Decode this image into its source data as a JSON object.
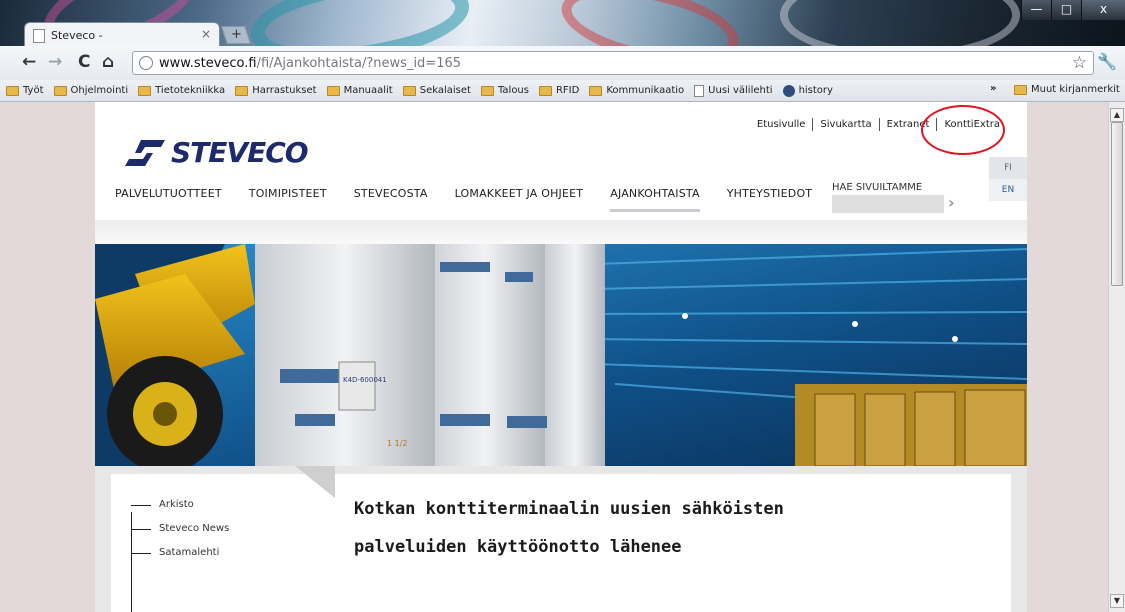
{
  "browser": {
    "tab_title": "Steveco -",
    "tab_close": "×",
    "new_tab": "+",
    "url_host": "www.steveco.fi",
    "url_rest": "/fi/Ajankohtaista/?news_id=165",
    "window_controls": {
      "minimize": "—",
      "maximize": "□",
      "close": "x"
    },
    "nav": {
      "back": "←",
      "forward": "→",
      "reload": "C",
      "home": "⌂"
    },
    "star": "☆",
    "wrench": "🔧",
    "bookmarks": [
      {
        "label": "Työt",
        "icon": "folder-icon"
      },
      {
        "label": "Ohjelmointi",
        "icon": "folder-icon"
      },
      {
        "label": "Tietotekniikka",
        "icon": "folder-icon"
      },
      {
        "label": "Harrastukset",
        "icon": "folder-icon"
      },
      {
        "label": "Manuaalit",
        "icon": "folder-icon"
      },
      {
        "label": "Sekalaiset",
        "icon": "folder-icon"
      },
      {
        "label": "Talous",
        "icon": "folder-icon"
      },
      {
        "label": "RFID",
        "icon": "folder-icon"
      },
      {
        "label": "Kommunikaatio",
        "icon": "folder-icon"
      },
      {
        "label": "Uusi välilehti",
        "icon": "page-icon"
      },
      {
        "label": "history",
        "icon": "clock-icon"
      }
    ],
    "bookmarks_more": "»",
    "other_bookmarks": "Muut kirjanmerkit"
  },
  "site": {
    "logo_text": "STEVECO",
    "top_links": [
      "Etusivulle",
      "Sivukartta",
      "Extranet",
      "KonttiExtra"
    ],
    "languages": [
      "FI",
      "EN"
    ],
    "main_nav": [
      {
        "label": "PALVELUTUOTTEET",
        "active": false
      },
      {
        "label": "TOIMIPISTEET",
        "active": false
      },
      {
        "label": "STEVECOSTA",
        "active": false
      },
      {
        "label": "LOMAKKEET JA OHJEET",
        "active": false
      },
      {
        "label": "AJANKOHTAISTA",
        "active": true
      },
      {
        "label": "YHTEYSTIEDOT",
        "active": false
      }
    ],
    "search_label": "HAE SIVUILTAMME",
    "search_go": "›",
    "side_nav": [
      "Arkisto",
      "Steveco News",
      "Satamalehti"
    ],
    "headline": "Kotkan konttiterminaalin uusien sähköisten palveluiden käyttöönotto lähenee",
    "hero_labels": [
      "K4D-600041",
      "1 1/2"
    ]
  },
  "colors": {
    "logo": "#1d2a6b",
    "annotation_circle": "#e0141e",
    "hero_sky": "#14507f"
  }
}
